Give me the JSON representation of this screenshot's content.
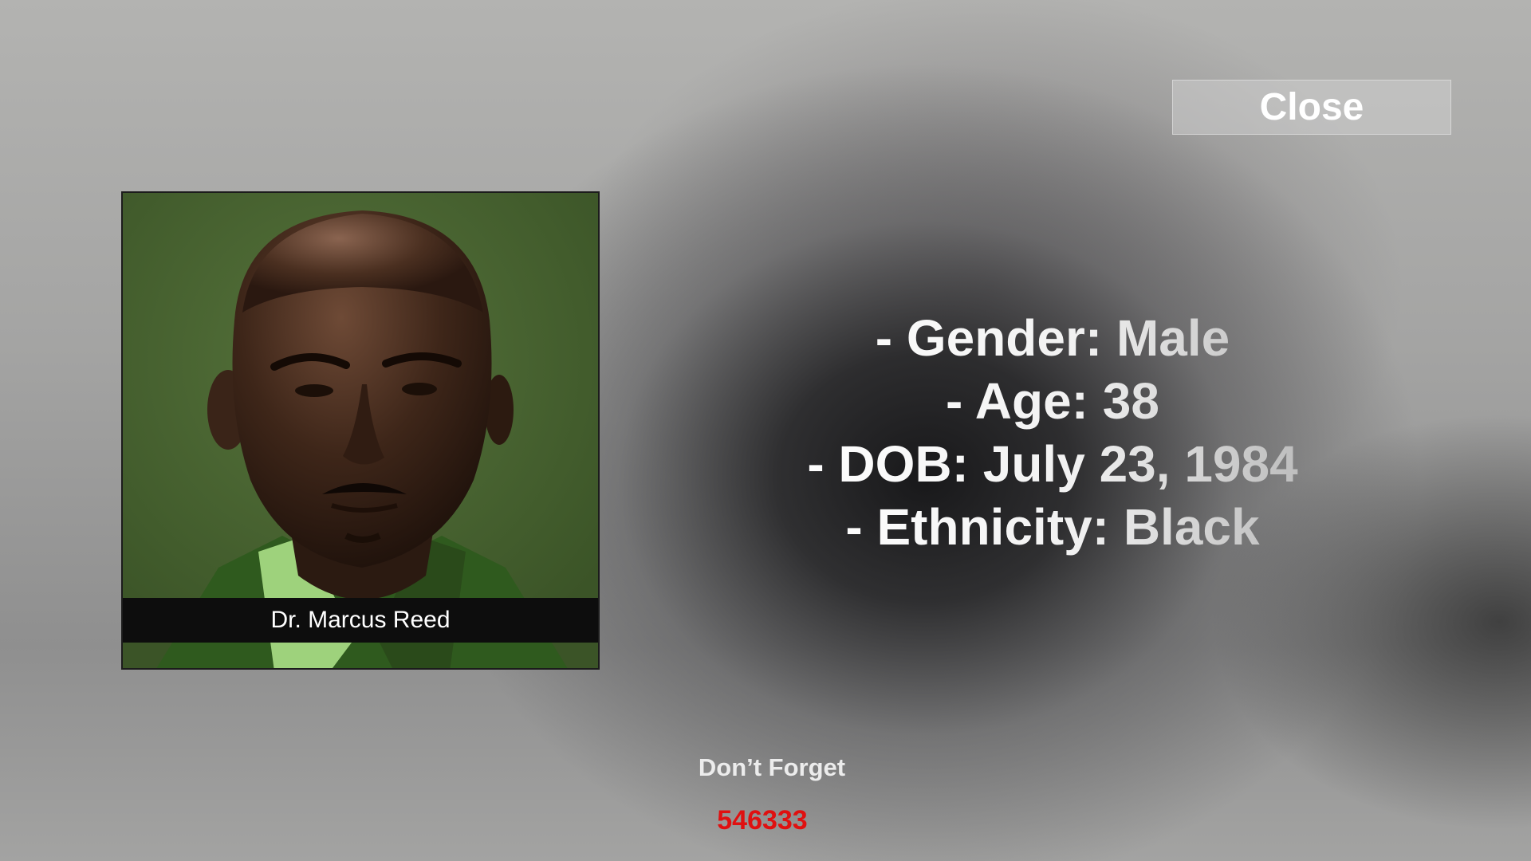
{
  "close_button": {
    "label": "Close"
  },
  "character": {
    "name": "Dr. Marcus Reed",
    "details": [
      "- Gender: Male",
      "- Age: 38",
      "- DOB: July 23, 1984",
      "- Ethnicity: Black"
    ]
  },
  "reminder": {
    "label": "Don’t Forget",
    "code": "546333"
  },
  "colors": {
    "portrait_background": "#46632e",
    "code_red": "#e01010",
    "name_plate": "#0d0d0d"
  }
}
